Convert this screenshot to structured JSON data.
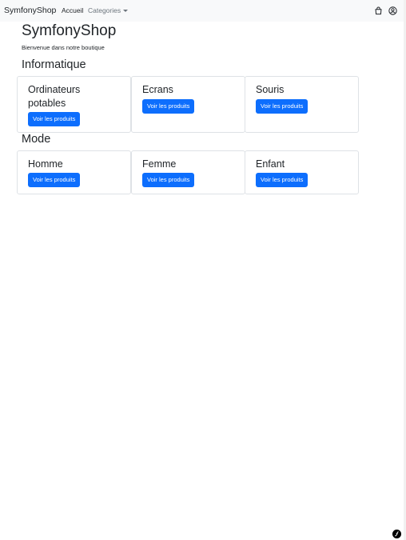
{
  "nav": {
    "brand": "SymfonyShop",
    "links": [
      {
        "label": "Accueil"
      },
      {
        "label": "Categories"
      }
    ]
  },
  "page": {
    "title": "SymfonyShop",
    "subtitle": "Bienvenue dans notre boutique"
  },
  "sections": [
    {
      "title": "Informatique",
      "categories": [
        {
          "name": "Ordinateurs potables",
          "button": "Voir les produits"
        },
        {
          "name": "Ecrans",
          "button": "Voir les produits"
        },
        {
          "name": "Souris",
          "button": "Voir les produits"
        }
      ]
    },
    {
      "title": "Mode",
      "categories": [
        {
          "name": "Homme",
          "button": "Voir les produits"
        },
        {
          "name": "Femme",
          "button": "Voir les produits"
        },
        {
          "name": "Enfant",
          "button": "Voir les produits"
        }
      ]
    }
  ],
  "icons": {
    "cart": "shopping-bag-icon",
    "user": "user-circle-icon",
    "toolbar": "symfony-toolbar-icon"
  },
  "colors": {
    "primary": "#0d6efd",
    "navbar_bg": "#f8f9fa",
    "muted": "#6c757d"
  }
}
